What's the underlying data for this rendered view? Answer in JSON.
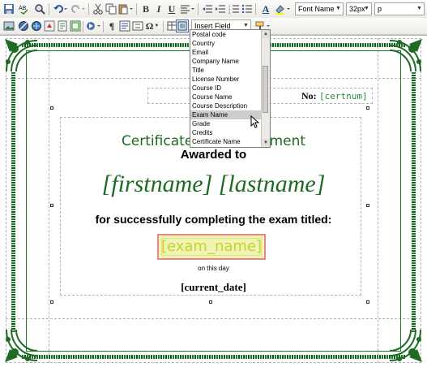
{
  "toolbar1": {
    "font_family": "Font Name",
    "font_size": "32px",
    "block_format": "p",
    "bold": "B",
    "italic": "I",
    "underline": "U",
    "font_color": "A"
  },
  "toolbar2": {
    "insert_field": "Insert Field",
    "omega": "Ω",
    "paragraph": "¶"
  },
  "insert_field_options": [
    "Postal code",
    "Country",
    "Email",
    "Company Name",
    "Title",
    "License Number",
    "Course ID",
    "Course Name",
    "Course Description",
    "Exam Name",
    "Grade",
    "Credits",
    "Certificate Name"
  ],
  "highlighted_option": "Exam Name",
  "certificate": {
    "number_label": "No:",
    "number_value": "[certnum]",
    "title": "Certificate of Achievement",
    "awarded": "Awarded to",
    "name": "[firstname] [lastname]",
    "completing": "for successfully completing the exam titled:",
    "exam": "[exam_name]",
    "on_day": "on this day",
    "date": "[current_date]"
  },
  "colors": {
    "border_green": "#1e7a2a",
    "title_green": "#1d6b22",
    "exam_fill": "#f0f3b4",
    "exam_border": "#e48a86",
    "exam_text": "#c5d428"
  }
}
